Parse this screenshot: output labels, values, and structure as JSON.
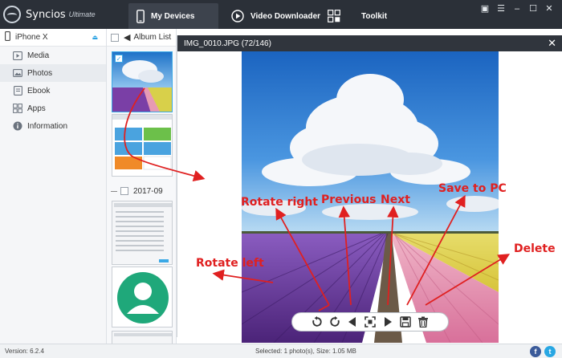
{
  "app": {
    "name": "Syncios",
    "edition": "Ultimate",
    "tabs": [
      {
        "label": "My Devices",
        "icon": "phone-icon",
        "active": true
      },
      {
        "label": "Video Downloader",
        "icon": "play-icon",
        "active": false
      },
      {
        "label": "Toolkit",
        "icon": "grid-icon",
        "active": false
      }
    ],
    "window_controls": [
      "chat-icon",
      "menu-icon",
      "minimize-icon",
      "maximize-icon",
      "close-icon"
    ]
  },
  "sidebar": {
    "device": "iPhone X",
    "items": [
      {
        "label": "Media",
        "icon": "media-icon",
        "active": false
      },
      {
        "label": "Photos",
        "icon": "photos-icon",
        "active": true
      },
      {
        "label": "Ebook",
        "icon": "ebook-icon",
        "active": false
      },
      {
        "label": "Apps",
        "icon": "apps-icon",
        "active": false
      },
      {
        "label": "Information",
        "icon": "info-icon",
        "active": false
      }
    ]
  },
  "photo_column": {
    "header": "Album List",
    "date_group": "2017-09"
  },
  "viewer": {
    "title": "IMG_0010.JPG (72/146)",
    "toolbar": [
      "rotate-left-icon",
      "rotate-right-icon",
      "previous-icon",
      "fullscreen-icon",
      "next-icon",
      "save-icon",
      "delete-icon"
    ]
  },
  "annotations": {
    "rotate_left": "Rotate left",
    "rotate_right": "Rotate right",
    "previous": "Previous",
    "next": "Next",
    "save_to_pc": "Save to PC",
    "delete": "Delete"
  },
  "status": {
    "version": "Version: 6.2.4",
    "selection": "Selected: 1 photo(s), Size: 1.05 MB",
    "social": [
      "facebook-icon",
      "twitter-icon"
    ]
  },
  "colors": {
    "titlebar": "#2b3038",
    "accent": "#2ea3e3",
    "annotation": "#e02020"
  }
}
